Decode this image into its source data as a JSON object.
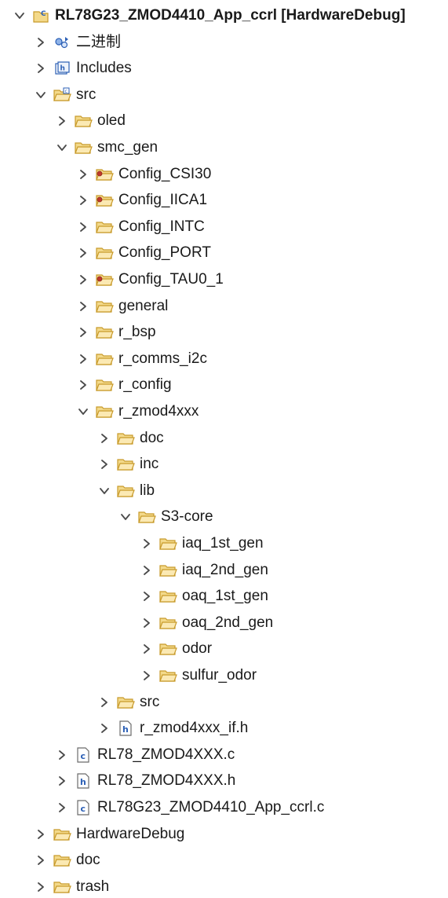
{
  "project_tree": {
    "items": [
      {
        "label": "RL78G23_ZMOD4410_App_ccrl [HardwareDebug]",
        "icon": "project-icon",
        "level": 0,
        "expanded": true
      },
      {
        "label": "二进制",
        "icon": "binaries-icon",
        "level": 1,
        "expanded": false
      },
      {
        "label": "Includes",
        "icon": "includes-icon",
        "level": 1,
        "expanded": false
      },
      {
        "label": "src",
        "icon": "source-folder-icon",
        "level": 1,
        "expanded": true
      },
      {
        "label": "oled",
        "icon": "folder-icon",
        "level": 2,
        "expanded": false
      },
      {
        "label": "smc_gen",
        "icon": "folder-icon",
        "level": 2,
        "expanded": true
      },
      {
        "label": "Config_CSI30",
        "icon": "config-folder-icon",
        "level": 3,
        "expanded": false
      },
      {
        "label": "Config_IICA1",
        "icon": "config-folder-icon",
        "level": 3,
        "expanded": false
      },
      {
        "label": "Config_INTC",
        "icon": "folder-icon",
        "level": 3,
        "expanded": false
      },
      {
        "label": "Config_PORT",
        "icon": "folder-icon",
        "level": 3,
        "expanded": false
      },
      {
        "label": "Config_TAU0_1",
        "icon": "config-folder-icon",
        "level": 3,
        "expanded": false
      },
      {
        "label": "general",
        "icon": "folder-icon",
        "level": 3,
        "expanded": false
      },
      {
        "label": "r_bsp",
        "icon": "folder-icon",
        "level": 3,
        "expanded": false
      },
      {
        "label": "r_comms_i2c",
        "icon": "folder-icon",
        "level": 3,
        "expanded": false
      },
      {
        "label": "r_config",
        "icon": "folder-icon",
        "level": 3,
        "expanded": false
      },
      {
        "label": "r_zmod4xxx",
        "icon": "folder-icon",
        "level": 3,
        "expanded": true
      },
      {
        "label": "doc",
        "icon": "folder-icon",
        "level": 4,
        "expanded": false
      },
      {
        "label": "inc",
        "icon": "folder-icon",
        "level": 4,
        "expanded": false
      },
      {
        "label": "lib",
        "icon": "folder-icon",
        "level": 4,
        "expanded": true
      },
      {
        "label": "S3-core",
        "icon": "folder-icon",
        "level": 5,
        "expanded": true
      },
      {
        "label": "iaq_1st_gen",
        "icon": "folder-icon",
        "level": 6,
        "expanded": false
      },
      {
        "label": "iaq_2nd_gen",
        "icon": "folder-icon",
        "level": 6,
        "expanded": false
      },
      {
        "label": "oaq_1st_gen",
        "icon": "folder-icon",
        "level": 6,
        "expanded": false
      },
      {
        "label": "oaq_2nd_gen",
        "icon": "folder-icon",
        "level": 6,
        "expanded": false
      },
      {
        "label": "odor",
        "icon": "folder-icon",
        "level": 6,
        "expanded": false
      },
      {
        "label": "sulfur_odor",
        "icon": "folder-icon",
        "level": 6,
        "expanded": false
      },
      {
        "label": "src",
        "icon": "folder-icon",
        "level": 4,
        "expanded": false
      },
      {
        "label": "r_zmod4xxx_if.h",
        "icon": "h-file-icon",
        "level": 4,
        "expanded": false
      },
      {
        "label": "RL78_ZMOD4XXX.c",
        "icon": "c-file-icon",
        "level": 2,
        "expanded": false
      },
      {
        "label": "RL78_ZMOD4XXX.h",
        "icon": "h-file-icon",
        "level": 2,
        "expanded": false
      },
      {
        "label": "RL78G23_ZMOD4410_App_ccrl.c",
        "icon": "c-file-icon",
        "level": 2,
        "expanded": false
      },
      {
        "label": "HardwareDebug",
        "icon": "folder-icon",
        "level": 1,
        "expanded": false
      },
      {
        "label": "doc",
        "icon": "folder-icon",
        "level": 1,
        "expanded": false
      },
      {
        "label": "trash",
        "icon": "folder-icon",
        "level": 1,
        "expanded": false
      }
    ]
  },
  "colors": {
    "folder_fill": "#f3d98a",
    "folder_stroke": "#c89a2a",
    "chevron": "#4a4a4a",
    "file_blue": "#2b5fb5",
    "text": "#1a1a1a"
  }
}
